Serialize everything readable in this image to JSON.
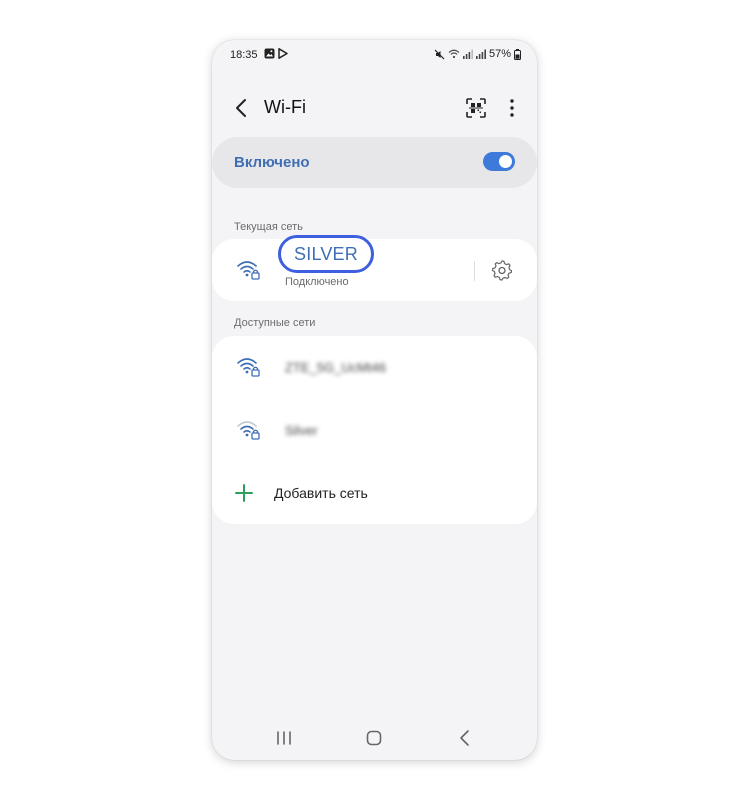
{
  "status_bar": {
    "time": "18:35",
    "battery": "57%",
    "left_icons": [
      "gallery-icon",
      "play-store-icon"
    ],
    "right_icons": [
      "mute-icon",
      "wifi-icon",
      "signal-icon",
      "signal-icon",
      "battery-icon"
    ]
  },
  "header": {
    "title": "Wi-Fi",
    "back_icon": "chevron-left-icon",
    "qr_icon": "qr-scan-icon",
    "more_icon": "more-vert-icon"
  },
  "toggle": {
    "label": "Включено",
    "on": true,
    "accent": "#3e7ad9",
    "label_color": "#3e6fb4"
  },
  "current_network": {
    "section_label": "Текущая сеть",
    "name": "SILVER",
    "status": "Подключено",
    "highlight_color": "#3d5fe0",
    "settings_icon": "gear-icon"
  },
  "available_networks": {
    "section_label": "Доступные сети",
    "items": [
      {
        "name": "ZTE_5G_UcMt46",
        "strength": "full",
        "secured": true
      },
      {
        "name": "Silver",
        "strength": "medium",
        "secured": true
      }
    ],
    "add_label": "Добавить сеть",
    "add_color": "#2e9e5b"
  },
  "nav_bar": {
    "buttons": [
      "recents-icon",
      "home-icon",
      "back-icon"
    ]
  }
}
